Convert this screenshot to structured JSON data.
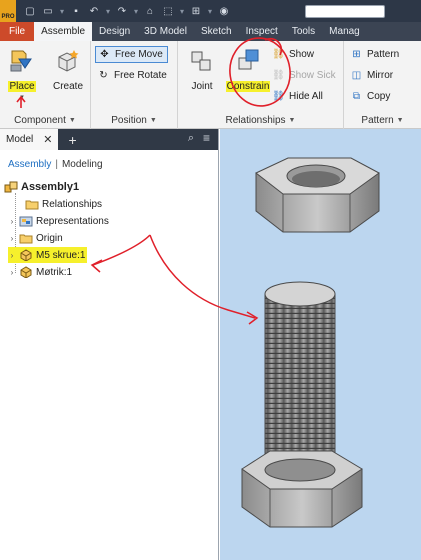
{
  "titlebar": {
    "logo_text": "PRO",
    "quick_access_icons": [
      "new-icon",
      "open-icon",
      "save-icon",
      "undo-icon",
      "redo-icon",
      "home-icon",
      "select-icon",
      "measure-icon",
      "material-icon"
    ],
    "search_value": ""
  },
  "tabs": [
    {
      "label": "File",
      "state": "file"
    },
    {
      "label": "Assemble",
      "state": "active"
    },
    {
      "label": "Design",
      "state": ""
    },
    {
      "label": "3D Model",
      "state": ""
    },
    {
      "label": "Sketch",
      "state": ""
    },
    {
      "label": "Inspect",
      "state": ""
    },
    {
      "label": "Tools",
      "state": ""
    },
    {
      "label": "Manag",
      "state": ""
    }
  ],
  "ribbon": {
    "component": {
      "label": "Component",
      "place": "Place",
      "create": "Create"
    },
    "position": {
      "label": "Position",
      "free_move": "Free Move",
      "free_rotate": "Free Rotate"
    },
    "relationships": {
      "label": "Relationships",
      "joint": "Joint",
      "constrain": "Constrain",
      "show": "Show",
      "show_sick": "Show Sick",
      "hide_all": "Hide All"
    },
    "pattern": {
      "label": "Pattern",
      "pattern": "Pattern",
      "mirror": "Mirror",
      "copy": "Copy"
    }
  },
  "browser": {
    "tab_label": "Model",
    "mode_active": "Assembly",
    "mode_separator": "|",
    "mode_other": "Modeling",
    "root": "Assembly1",
    "items": [
      {
        "label": "Relationships",
        "icon": "folder-icon",
        "expandable": false
      },
      {
        "label": "Representations",
        "icon": "representations-icon",
        "expandable": true
      },
      {
        "label": "Origin",
        "icon": "folder-icon",
        "expandable": true
      },
      {
        "label": "M5 skrue:1",
        "icon": "part-icon",
        "expandable": true,
        "highlighted": true
      },
      {
        "label": "Møtrik:1",
        "icon": "part-icon",
        "expandable": true
      }
    ]
  },
  "colors": {
    "title_bg": "#2d3747",
    "tab_bg": "#3b4453",
    "file_tab": "#cd4a2a",
    "ribbon_bg": "#f3f3f3",
    "highlight": "#f6f02c",
    "annotation_red": "#e0202a",
    "viewport_bg": "#bcd6ef",
    "link_blue": "#1e6fc2"
  }
}
